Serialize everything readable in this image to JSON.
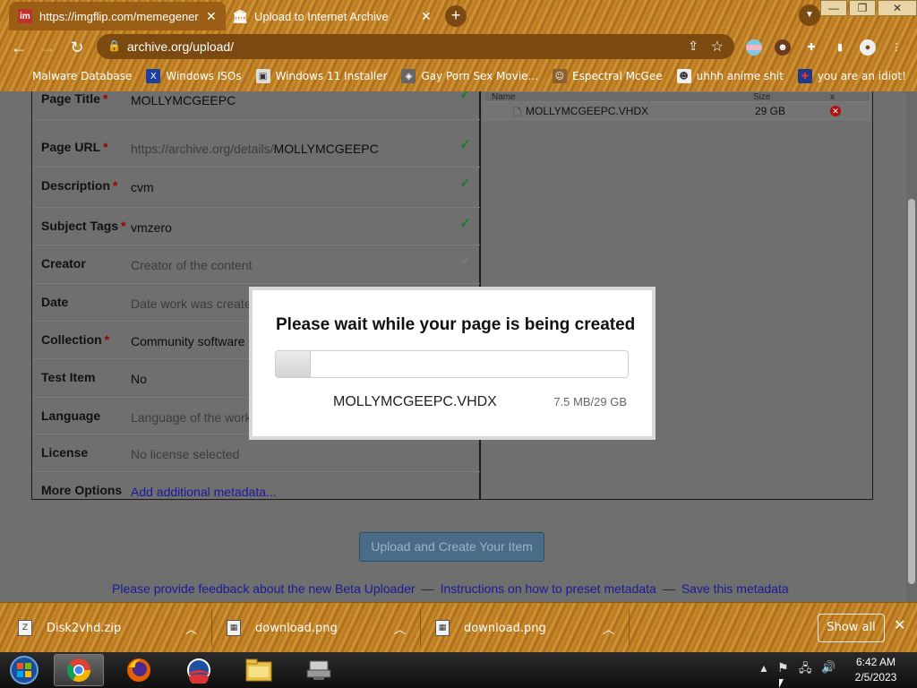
{
  "browser": {
    "tabs": [
      {
        "title": "https://imgflip.com/memegenerator",
        "favicon": "imgflip-icon",
        "active": true
      },
      {
        "title": "Upload to Internet Archive",
        "favicon": "archive-icon",
        "active": false
      }
    ],
    "url": "archive.org/upload/",
    "window_controls": {
      "minimize": "—",
      "maximize": "❐",
      "close": "✕"
    },
    "bookmarks": [
      {
        "label": "Malware Database",
        "icon": "folder-icon"
      },
      {
        "label": "Windows ISOs",
        "icon": "x-icon"
      },
      {
        "label": "Windows 11 Installer",
        "icon": "installer-icon"
      },
      {
        "label": "Gay Porn Sex Movie...",
        "icon": "site-icon"
      },
      {
        "label": "Espectral McGee",
        "icon": "avatar-icon"
      },
      {
        "label": "uhhh anime shit",
        "icon": "anime-icon"
      },
      {
        "label": "you are an idiot!",
        "icon": "flag-icon"
      }
    ]
  },
  "form": {
    "rows": [
      {
        "label": "Page Title",
        "required": true,
        "value": "MOLLYMCGEEPC",
        "placeholder": false,
        "valid": true
      },
      {
        "label": "Page URL",
        "required": true,
        "value_prefix": "https://archive.org/details/",
        "value": "MOLLYMCGEEPC",
        "placeholder": false,
        "valid": true
      },
      {
        "label": "Description",
        "required": true,
        "value": "cvm",
        "placeholder": false,
        "valid": true
      },
      {
        "label": "Subject Tags",
        "required": true,
        "value": "vmzero",
        "placeholder": false,
        "valid": true
      },
      {
        "label": "Creator",
        "required": false,
        "value": "Creator of the content",
        "placeholder": true,
        "valid": false
      },
      {
        "label": "Date",
        "required": false,
        "value": "Date work was created",
        "placeholder": true,
        "valid": false
      },
      {
        "label": "Collection",
        "required": true,
        "value": "Community software",
        "placeholder": false,
        "valid": false
      },
      {
        "label": "Test Item",
        "required": false,
        "value": "No",
        "placeholder": false,
        "valid": false
      },
      {
        "label": "Language",
        "required": false,
        "value": "Language of the work",
        "placeholder": true,
        "valid": false
      },
      {
        "label": "License",
        "required": false,
        "value": "No license selected",
        "placeholder": true,
        "valid": false
      },
      {
        "label": "More Options",
        "required": false,
        "value": "Add additional metadata...",
        "placeholder": false,
        "valid": false,
        "link": true
      }
    ]
  },
  "files": {
    "columns": [
      "Name",
      "Size",
      "x"
    ],
    "rows": [
      {
        "name": "MOLLYMCGEEPC.VHDX",
        "size": "29 GB"
      }
    ]
  },
  "upload_button": "Upload and Create Your Item",
  "footer_links": [
    "Please provide feedback about the new Beta Uploader",
    "Instructions on how to preset metadata",
    "Save this metadata"
  ],
  "footer_separator": "—",
  "modal": {
    "title": "Please wait while your page is being created",
    "file_name": "MOLLYMCGEEPC.VHDX",
    "progress_text": "7.5 MB/29 GB",
    "progress_fraction": 0.1
  },
  "downloads": {
    "items": [
      {
        "name": "Disk2vhd.zip",
        "icon": "zip-icon"
      },
      {
        "name": "download.png",
        "icon": "image-icon"
      },
      {
        "name": "download.png",
        "icon": "image-icon"
      }
    ],
    "show_all": "Show all"
  },
  "taskbar": {
    "apps": [
      "start-orb",
      "chrome",
      "firefox",
      "obama-logo",
      "file-explorer",
      "network-app"
    ],
    "time": "6:42 AM",
    "date": "2/5/2023"
  }
}
